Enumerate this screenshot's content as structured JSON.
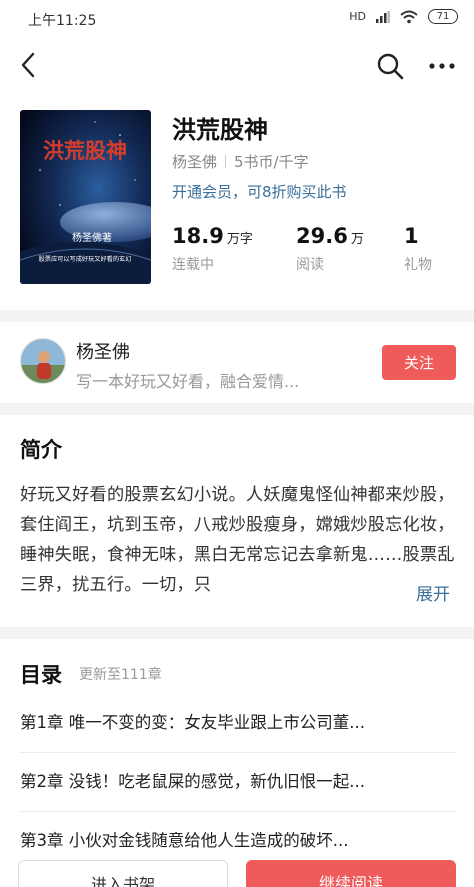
{
  "status_bar": {
    "time": "上午11:25",
    "signal": "HD",
    "battery": "71"
  },
  "book": {
    "title": "洪荒股神",
    "cover_title": "洪荒股神",
    "cover_author": "杨圣佛著",
    "cover_tagline": "股票应可以写成好玩又好看的玄幻",
    "author": "杨圣佛",
    "price": "5书币/千字",
    "member_offer": "开通会员，可8折购买此书",
    "stats": [
      {
        "value": "18.9",
        "unit": "万字",
        "label": "连载中"
      },
      {
        "value": "29.6",
        "unit": "万",
        "label": "阅读"
      },
      {
        "value": "1",
        "unit": "",
        "label": "礼物"
      }
    ]
  },
  "author_card": {
    "name": "杨圣佛",
    "bio": "写一本好玩又好看，融合爱情...",
    "follow_label": "关注"
  },
  "intro": {
    "title": "简介",
    "text": "好玩又好看的股票玄幻小说。人妖魔鬼怪仙神都来炒股，套住阎王，坑到玉帝，八戒炒股瘦身，嫦娥炒股忘化妆，睡神失眠，食神无味，黑白无常忘记去拿新鬼……股票乱三界，扰五行。一切，只",
    "expand_label": "展开"
  },
  "catalog": {
    "title": "目录",
    "update": "更新至111章",
    "chapters": [
      "第1章  唯一不变的变：女友毕业跟上市公司董...",
      "第2章  没钱！吃老鼠屎的感觉，新仇旧恨一起...",
      "第3章  小伙对金钱随意给他人生造成的破坏..."
    ]
  },
  "bottom_bar": {
    "shelf_label": "进入书架",
    "read_label": "继续阅读"
  },
  "colors": {
    "accent": "#ef5a5a",
    "link": "#3a6f9b"
  }
}
